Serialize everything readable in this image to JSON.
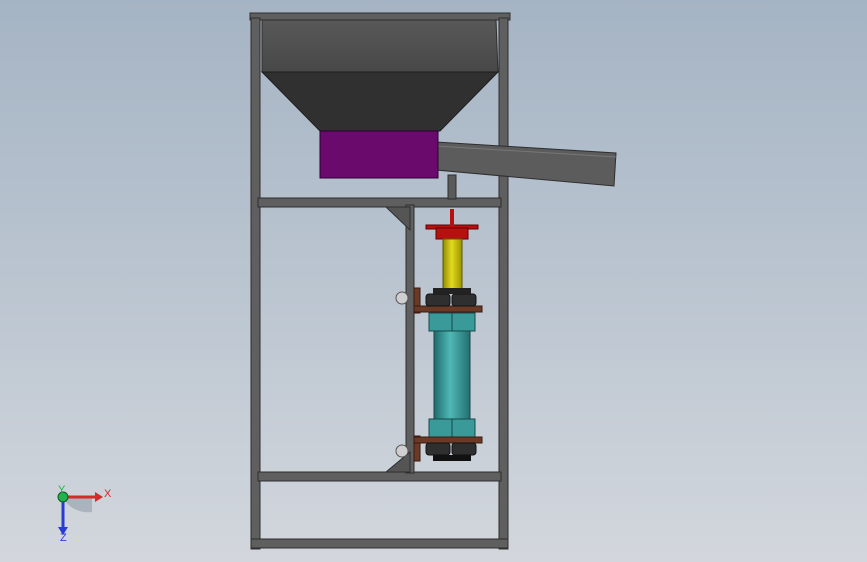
{
  "scene": {
    "title": "",
    "view": "front"
  },
  "triad": {
    "x_label": "X",
    "y_label": "Y",
    "z_label": "Z",
    "x_color": "#d42a2a",
    "y_color": "#22b14c",
    "z_color": "#2a3bd4"
  },
  "colors": {
    "frame": "#5f5f5f",
    "frame_edge": "#2e2e2e",
    "hopper_top": "#545454",
    "hopper_bottom": "#303030",
    "chute": "#5c5c5c",
    "outlet_box": "#6a0a6c",
    "valve_cap": "#b71010",
    "rod": "#c8c000",
    "cylinder": "#3a9a9a",
    "bracket": "#6b3a26",
    "nut": "#2f2f2f"
  },
  "components": [
    {
      "name": "frame",
      "icon": "frame-icon"
    },
    {
      "name": "hopper",
      "icon": "hopper-icon"
    },
    {
      "name": "outlet-box",
      "icon": "box-icon"
    },
    {
      "name": "discharge-chute",
      "icon": "chute-icon"
    },
    {
      "name": "valve-gate",
      "icon": "valve-icon"
    },
    {
      "name": "piston-rod",
      "icon": "rod-icon"
    },
    {
      "name": "pneumatic-cylinder",
      "icon": "cylinder-icon"
    },
    {
      "name": "mounting-bracket-upper",
      "icon": "bracket-icon"
    },
    {
      "name": "mounting-bracket-lower",
      "icon": "bracket-icon"
    }
  ]
}
